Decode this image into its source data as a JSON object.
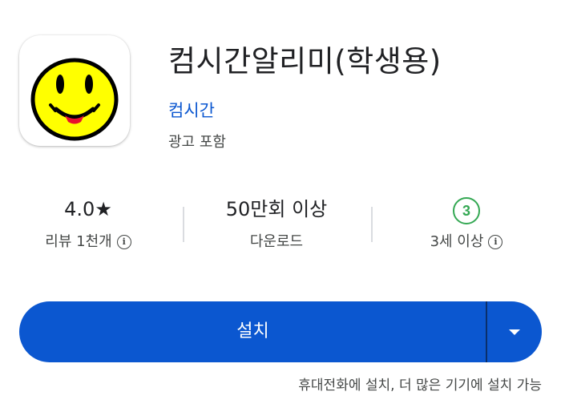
{
  "app": {
    "title": "컴시간알리미(학생용)",
    "developer": "컴시간",
    "ads_note": "광고 포함",
    "icon": "smiley-face-icon"
  },
  "stats": {
    "rating": {
      "value": "4.0★",
      "label": "리뷰 1천개",
      "info_icon": "info-icon"
    },
    "downloads": {
      "value": "50만회 이상",
      "label": "다운로드"
    },
    "age": {
      "badge": "3",
      "label": "3세 이상",
      "info_icon": "info-icon"
    }
  },
  "install": {
    "label": "설치",
    "dropdown_icon": "caret-down-icon",
    "note": "휴대전화에 설치, 더 많은 기기에 설치 가능"
  },
  "colors": {
    "accent": "#0b57d0",
    "age_badge": "#34a853",
    "icon_face": "#ffff00"
  }
}
